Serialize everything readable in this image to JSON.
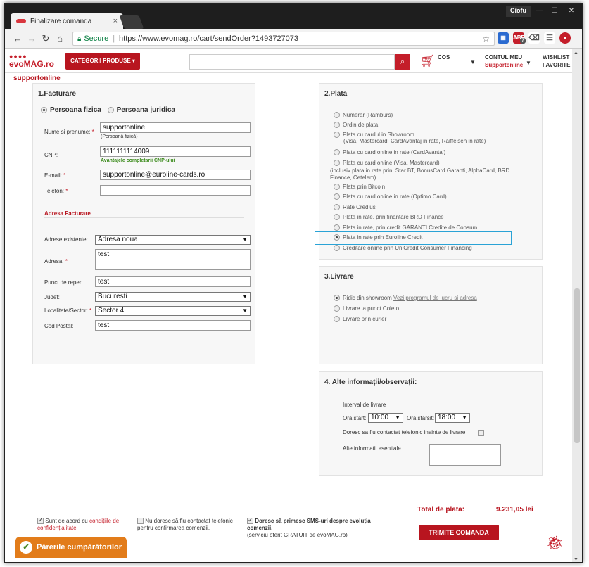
{
  "browser": {
    "tab_title": "Finalizare comanda",
    "tab_close": "×",
    "user_badge": "Ciofu",
    "secure_label": "Secure",
    "url": "https://www.evomag.ro/cart/sendOrder?1493727073",
    "ext_count": "7"
  },
  "header": {
    "logo": "evoMAG.ro",
    "categories_button": "CATEGORII PRODUSE ▾",
    "cart_label": "COS",
    "account_label": "CONTUL MEU",
    "account_user": "Supportonline",
    "wishlist_line1": "WISHLIST",
    "wishlist_line2": "FAVORITE"
  },
  "page": {
    "username": "supportonline"
  },
  "billing": {
    "title": "1.Facturare",
    "person_fizica": "Persoana fizica",
    "person_juridica": "Persoana juridica",
    "name_label": "Nume si prenume:",
    "name_value": "supportonline",
    "name_hint": "(Persoană fizică)",
    "cnp_label": "CNP:",
    "cnp_value": "1111111114009",
    "cnp_hint": "Avantajele completarii CNP-ului",
    "email_label": "E-mail:",
    "email_value": "supportonline@euroline-cards.ro",
    "phone_label": "Telefon:",
    "phone_value": "",
    "address_section": "Adresa Facturare",
    "existing_label": "Adrese existente:",
    "existing_value": "Adresa noua",
    "address_label": "Adresa:",
    "address_value": "test",
    "landmark_label": "Punct de reper:",
    "landmark_value": "test",
    "county_label": "Judet:",
    "county_value": "Bucuresti",
    "city_label": "Localitate/Sector:",
    "city_value": "Sector 4",
    "postal_label": "Cod Postal:",
    "postal_value": "test",
    "req_mark": "*"
  },
  "payment": {
    "title": "2.Plata",
    "options": [
      {
        "label": "Numerar (Ramburs)",
        "sub": ""
      },
      {
        "label": "Ordin de plata",
        "sub": ""
      },
      {
        "label": "Plata cu cardul in Showroom",
        "sub": "(Visa, Mastercard, CardAvantaj in rate, Raiffeisen in rate)"
      },
      {
        "label": "Plata cu card online in rate (CardAvantaj)",
        "sub": ""
      },
      {
        "label": "Plata cu card online (Visa, Mastercard)",
        "sub": ""
      },
      {
        "label": "Plata prin Bitcoin",
        "sub": ""
      },
      {
        "label": "Plata cu card online in rate (Optimo Card)",
        "sub": ""
      },
      {
        "label": "Rate Credius",
        "sub": ""
      },
      {
        "label": "Plata in rate, prin finantare BRD Finance",
        "sub": ""
      },
      {
        "label": "Plata in rate, prin credit GARANTI Credite de Consum",
        "sub": ""
      },
      {
        "label": "Plata in rate prin Euroline Credit",
        "sub": ""
      },
      {
        "label": "Creditare online prin UniCredit Consumer Financing",
        "sub": ""
      }
    ],
    "online_note": "(inclusiv plata in rate prin: Star BT, BonusCard Garanti, AlphaCard, BRD Finance, Cetelem)"
  },
  "delivery": {
    "title": "3.Livrare",
    "opt1": "Ridic din showroom",
    "opt1_link": "Vezi programul de lucru si adresa",
    "opt2": "Livrare la punct Coleto",
    "opt3": "Livrare prin curier"
  },
  "other": {
    "title": "4. Alte informații/observații:",
    "interval_label": "Interval de livrare",
    "start_label": "Ora start:",
    "start_value": "10:00",
    "end_label": "Ora sfarsit:",
    "end_value": "18:00",
    "contact_label": "Doresc sa fiu contactat telefonic inainte de livrare",
    "notes_label": "Alte informatii esentiale"
  },
  "footer": {
    "agree1_text": "Sunt de acord cu",
    "agree1_link": "condițiile de confidențialitate",
    "agree2": "Nu doresc să fiu contactat telefonic pentru confirmarea comenzii.",
    "agree3_bold": "Doresc să primesc SMS-uri despre evoluția comenzii.",
    "agree3_sub": "(serviciu oferit GRATUIT de evoMAG.ro)",
    "total_label": "Total de plata:",
    "total_value": "9.231,05 lei",
    "submit": "TRIMITE COMANDA",
    "feedback": "Părerile cumpărătorilor"
  }
}
